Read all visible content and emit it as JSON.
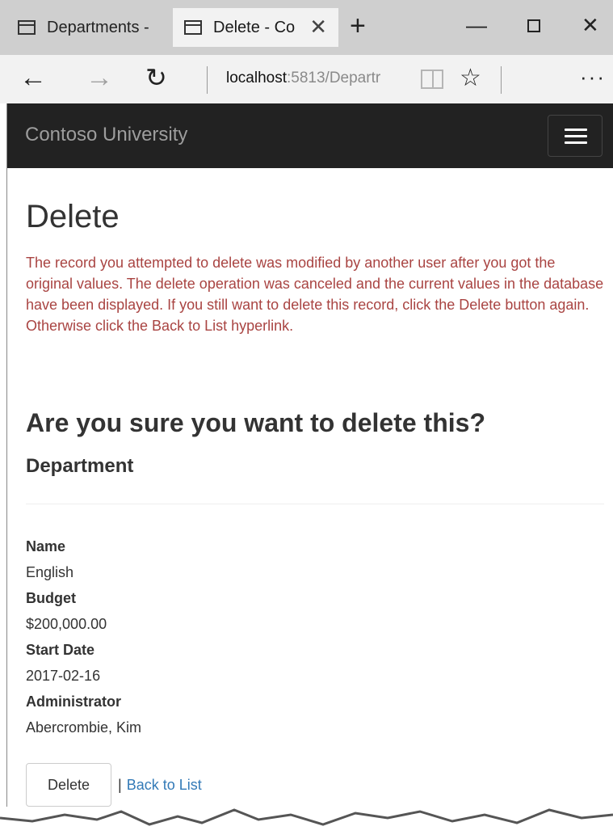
{
  "browser": {
    "tabs": [
      {
        "title": "Departments -",
        "active": false
      },
      {
        "title": "Delete - Co",
        "active": true
      }
    ],
    "new_tab_icon": "+",
    "window_controls": {
      "minimize": "—",
      "close": "✕"
    },
    "nav": {
      "back_icon": "←",
      "forward_icon": "→",
      "refresh_icon": "↻"
    },
    "url": {
      "host": "localhost",
      "path": ":5813/Departr"
    },
    "star_icon": "☆",
    "more_icon": "···",
    "tab_close_icon": "✕"
  },
  "site": {
    "brand": "Contoso University"
  },
  "page": {
    "title": "Delete",
    "error_message": "The record you attempted to delete was modified by another user after you got the original values. The delete operation was canceled and the current values in the database have been displayed. If you still want to delete this record, click the Delete button again. Otherwise click the Back to List hyperlink.",
    "confirm_heading": "Are you sure you want to delete this?",
    "entity_heading": "Department",
    "fields": [
      {
        "label": "Name",
        "value": "English"
      },
      {
        "label": "Budget",
        "value": "$200,000.00"
      },
      {
        "label": "Start Date",
        "value": "2017-02-16"
      },
      {
        "label": "Administrator",
        "value": "Abercrombie, Kim"
      }
    ],
    "delete_button": "Delete",
    "separator": "|",
    "back_link": "Back to List"
  },
  "colors": {
    "navbar_bg": "#222222",
    "brand_text": "#9d9d9d",
    "error_text": "#a94442",
    "link": "#337ab7"
  }
}
